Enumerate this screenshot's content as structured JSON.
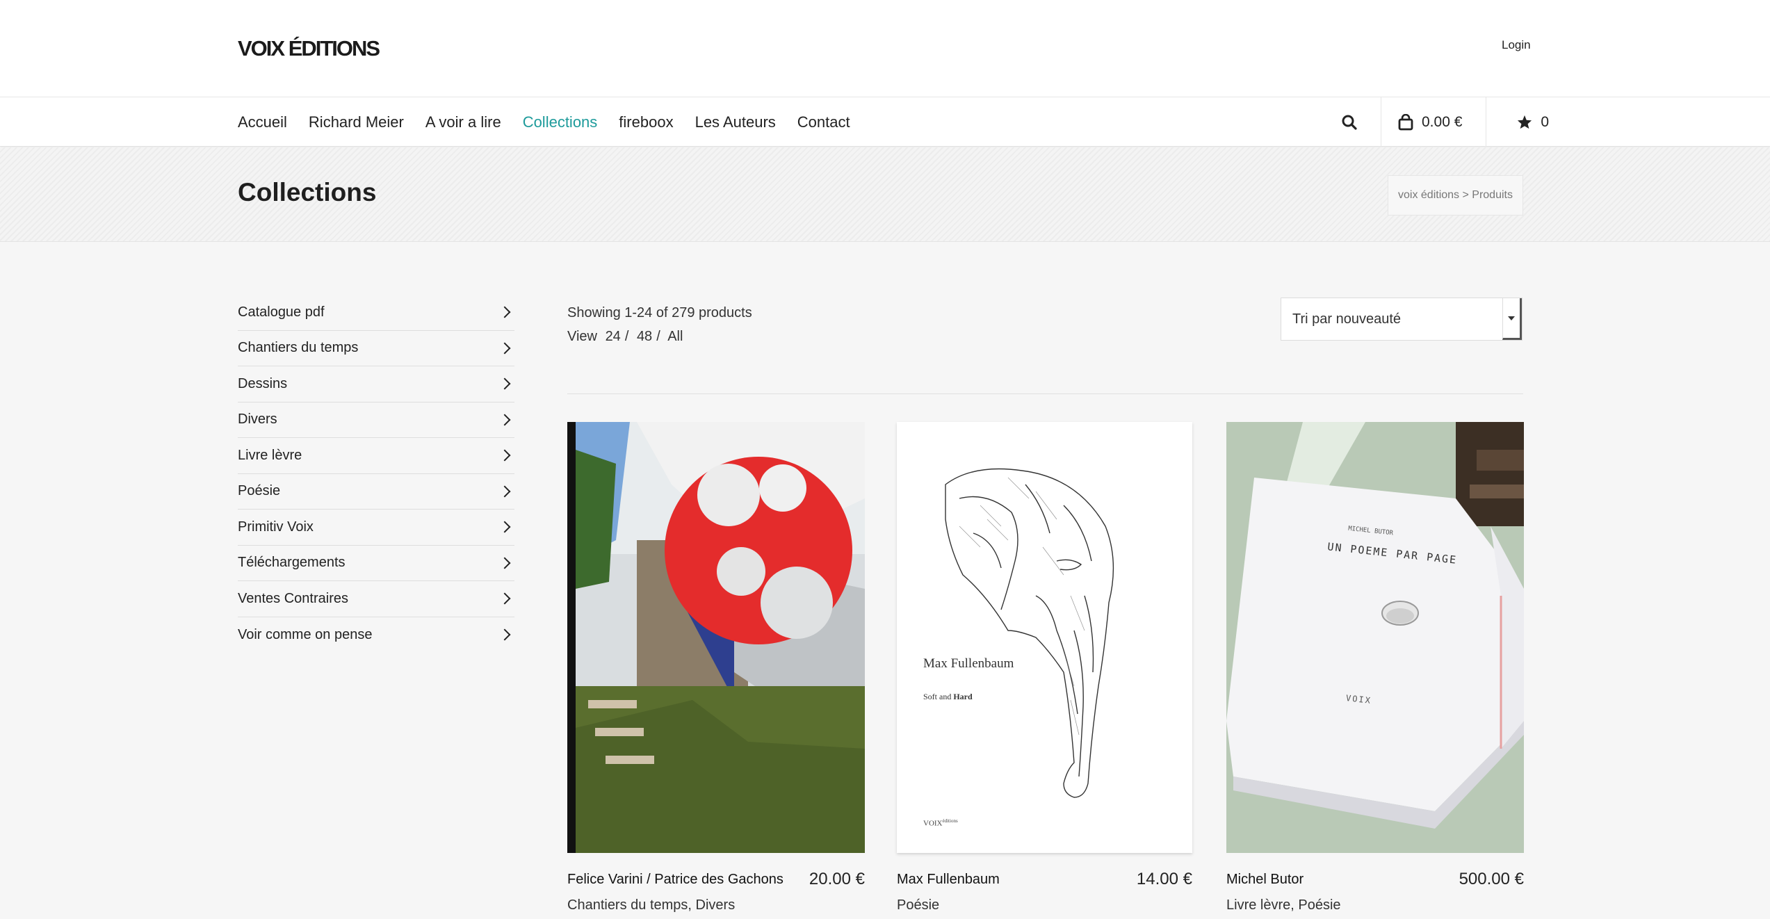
{
  "header": {
    "logo": "VOIX ÉDITIONS",
    "login": "Login"
  },
  "nav": {
    "items": [
      {
        "label": "Accueil",
        "active": false
      },
      {
        "label": "Richard Meier",
        "active": false
      },
      {
        "label": "A voir a lire",
        "active": false
      },
      {
        "label": "Collections",
        "active": true
      },
      {
        "label": "fireboox",
        "active": false
      },
      {
        "label": "Les Auteurs",
        "active": false
      },
      {
        "label": "Contact",
        "active": false
      }
    ],
    "search_icon": "search-icon",
    "cart_total": "0.00 €",
    "cart_icon": "shopping-bag-icon",
    "favorites_count": "0",
    "favorites_icon": "star-icon"
  },
  "page": {
    "title": "Collections",
    "breadcrumb": "voix éditions > Produits"
  },
  "sidebar": {
    "categories": [
      "Catalogue pdf",
      "Chantiers du temps",
      "Dessins",
      "Divers",
      "Livre lèvre",
      "Poésie",
      "Primitiv Voix",
      "Téléchargements",
      "Ventes Contraires",
      "Voir comme on pense"
    ]
  },
  "results": {
    "showing": "Showing 1-24 of 279 products",
    "view_label": "View",
    "view_options": [
      "24",
      "48",
      "All"
    ],
    "sort_value": "Tri par nouveauté"
  },
  "products": [
    {
      "name": "Felice Varini / Patrice des Gachons",
      "price": "20.00 €",
      "categories": "Chantiers du temps, Divers"
    },
    {
      "name": "Max Fullenbaum",
      "price": "14.00 €",
      "categories": "Poésie",
      "cover_author": "Max Fullenbaum",
      "cover_subtitle_a": "Soft and ",
      "cover_subtitle_b": "Hard",
      "cover_publisher": "VOIX",
      "cover_publisher_small": "éditions"
    },
    {
      "name": "Michel Butor",
      "price": "500.00 €",
      "categories": "Livre lèvre, Poésie",
      "cover_author": "MICHEL BUTOR",
      "cover_title": "UN POEME PAR PAGE",
      "cover_publisher": "VOIX"
    }
  ],
  "colors": {
    "accent": "#1e9b9b",
    "text": "#222222",
    "background": "#f6f6f6"
  }
}
